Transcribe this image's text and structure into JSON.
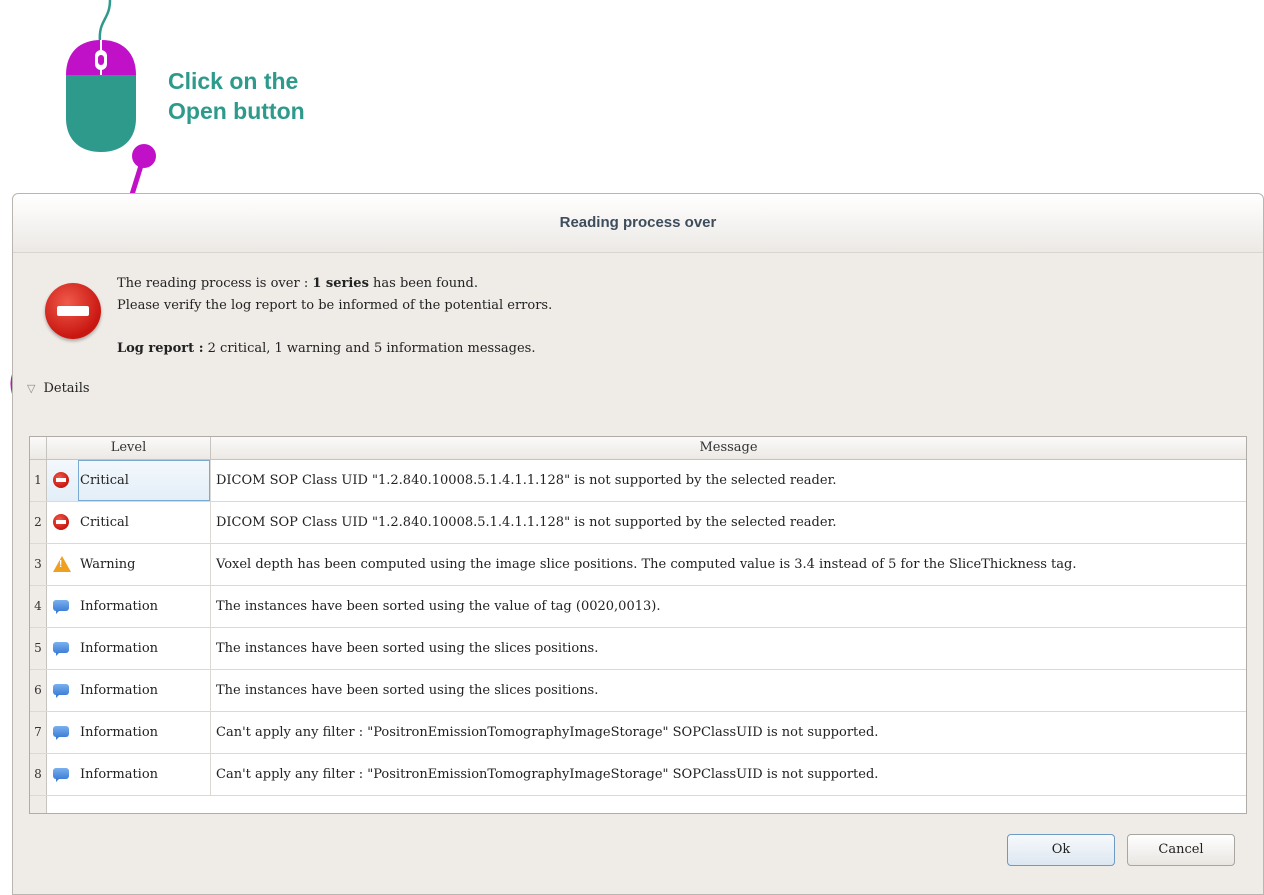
{
  "callout": {
    "line1": "Click on the",
    "line2": "Open button"
  },
  "dialog": {
    "title": "Reading process over",
    "summary": {
      "prefix": "The reading process is over : ",
      "count_bold": "1 series",
      "suffix": " has been found.",
      "line2": "Please verify the log report to be informed of the potential errors.",
      "log_label": "Log report :",
      "log_text": " 2 critical, 1 warning and 5 information messages."
    },
    "details_label": "Details",
    "table": {
      "headers": {
        "level": "Level",
        "message": "Message"
      },
      "rows": [
        {
          "num": "1",
          "icon": "critical-icon",
          "level": "Critical",
          "message": "DICOM SOP Class UID \"1.2.840.10008.5.1.4.1.1.128\" is not supported by the selected reader."
        },
        {
          "num": "2",
          "icon": "critical-icon",
          "level": "Critical",
          "message": "DICOM SOP Class UID \"1.2.840.10008.5.1.4.1.1.128\" is not supported by the selected reader."
        },
        {
          "num": "3",
          "icon": "warning-icon",
          "level": "Warning",
          "message": "Voxel depth has been computed using the image slice positions. The computed value is 3.4 instead of 5 for the SliceThickness tag."
        },
        {
          "num": "4",
          "icon": "information-icon",
          "level": "Information",
          "message": "The instances have been sorted using the value of tag (0020,0013)."
        },
        {
          "num": "5",
          "icon": "information-icon",
          "level": "Information",
          "message": "The instances have been sorted using the slices positions."
        },
        {
          "num": "6",
          "icon": "information-icon",
          "level": "Information",
          "message": "The instances have been sorted using the slices positions."
        },
        {
          "num": "7",
          "icon": "information-icon",
          "level": "Information",
          "message": "Can't apply any filter : \"PositronEmissionTomographyImageStorage\" SOPClassUID is not supported."
        },
        {
          "num": "8",
          "icon": "information-icon",
          "level": "Information",
          "message": "Can't apply any filter : \"PositronEmissionTomographyImageStorage\" SOPClassUID is not supported."
        }
      ]
    },
    "buttons": {
      "ok": "Ok",
      "cancel": "Cancel"
    }
  },
  "colors": {
    "annotation": "#c010c8",
    "teal": "#2e9a8c"
  }
}
